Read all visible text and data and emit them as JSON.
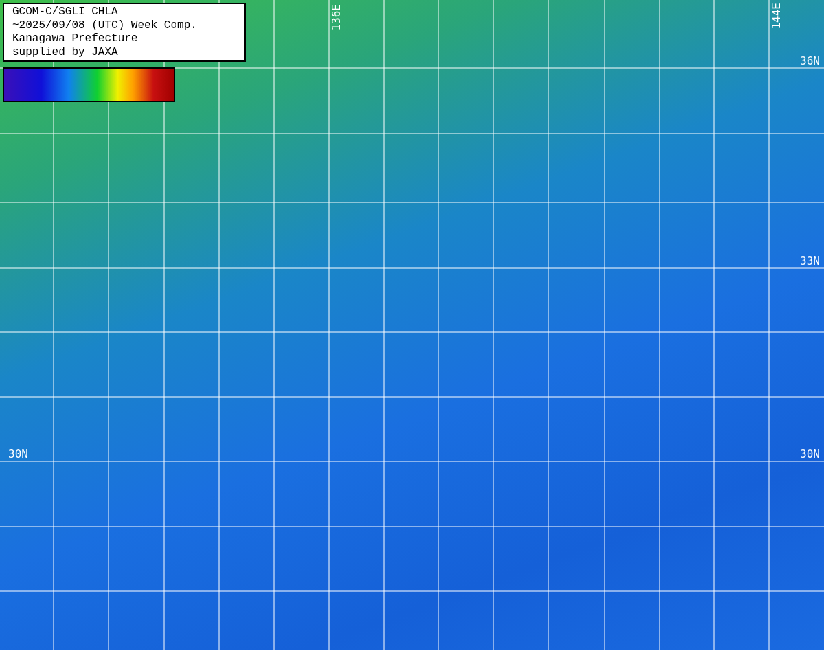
{
  "legend": {
    "lines": [
      "GCOM-C/SGLI CHLA",
      "~2025/09/08 (UTC) Week Comp.",
      "Kanagawa Prefecture",
      "supplied by JAXA"
    ]
  },
  "grid_labels": [
    {
      "text": "136E",
      "kind": "lon"
    },
    {
      "text": "144E",
      "kind": "lon"
    },
    {
      "text": "36N",
      "kind": "lat"
    },
    {
      "text": "33N",
      "kind": "lat"
    },
    {
      "text": "30N",
      "kind": "lat"
    },
    {
      "text": "30N",
      "kind": "lat"
    }
  ]
}
